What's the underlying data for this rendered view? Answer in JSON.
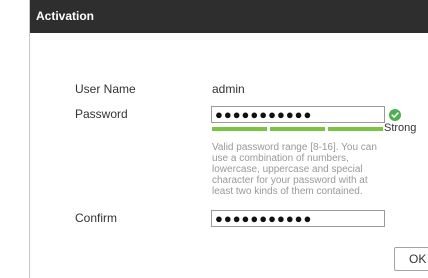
{
  "dialog": {
    "title": "Activation",
    "username": {
      "label": "User Name",
      "value": "admin"
    },
    "password": {
      "label": "Password",
      "value": "●●●●●●●●●●●",
      "strength_segments_filled": 3,
      "strength_segments_total": 3,
      "strength_label": "Strong",
      "strength_color": "#7bc441",
      "valid_icon": "check-circle-icon",
      "valid_icon_color": "#4caf50"
    },
    "hint": "Valid password range [8-16]. You can use a combination of numbers, lowercase, uppercase and special character for your password with at least two kinds of them contained.",
    "confirm": {
      "label": "Confirm",
      "value": "●●●●●●●●●●●"
    },
    "ok_label": "OK"
  },
  "colors": {
    "titlebar": "#2e2e2e",
    "hint_text": "#999999"
  }
}
